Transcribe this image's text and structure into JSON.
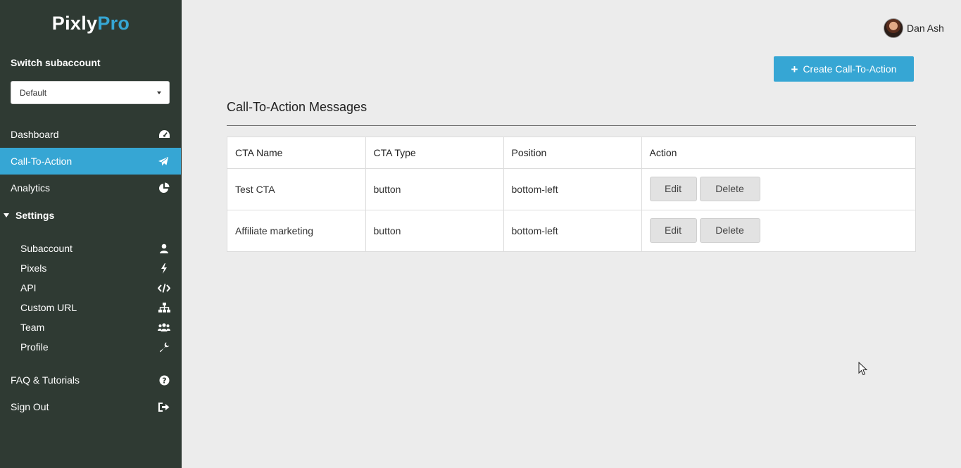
{
  "sidebar": {
    "logo_part1": "Pixly",
    "logo_part2": "Pro",
    "switch_label": "Switch subaccount",
    "subaccount_selected": "Default",
    "nav": [
      {
        "label": "Dashboard",
        "icon": "dashboard-icon"
      },
      {
        "label": "Call-To-Action",
        "icon": "paper-plane-icon",
        "active": true
      },
      {
        "label": "Analytics",
        "icon": "pie-chart-icon"
      }
    ],
    "settings_label": "Settings",
    "settings_items": [
      {
        "label": "Subaccount",
        "icon": "user-icon"
      },
      {
        "label": "Pixels",
        "icon": "bolt-icon"
      },
      {
        "label": "API",
        "icon": "code-icon"
      },
      {
        "label": "Custom URL",
        "icon": "sitemap-icon"
      },
      {
        "label": "Team",
        "icon": "users-icon"
      },
      {
        "label": "Profile",
        "icon": "wrench-icon"
      }
    ],
    "faq_label": "FAQ & Tutorials",
    "signout_label": "Sign Out"
  },
  "header": {
    "user_name": "Dan Ash",
    "create_button_label": "Create Call-To-Action"
  },
  "main": {
    "title": "Call-To-Action Messages",
    "table": {
      "columns": [
        "CTA Name",
        "CTA Type",
        "Position",
        "Action"
      ],
      "rows": [
        {
          "name": "Test CTA",
          "type": "button",
          "position": "bottom-left"
        },
        {
          "name": "Affiliate marketing",
          "type": "button",
          "position": "bottom-left"
        }
      ],
      "edit_label": "Edit",
      "delete_label": "Delete"
    }
  },
  "colors": {
    "sidebar_bg": "#2f3a33",
    "accent": "#36a6d4",
    "page_bg": "#ececec"
  }
}
